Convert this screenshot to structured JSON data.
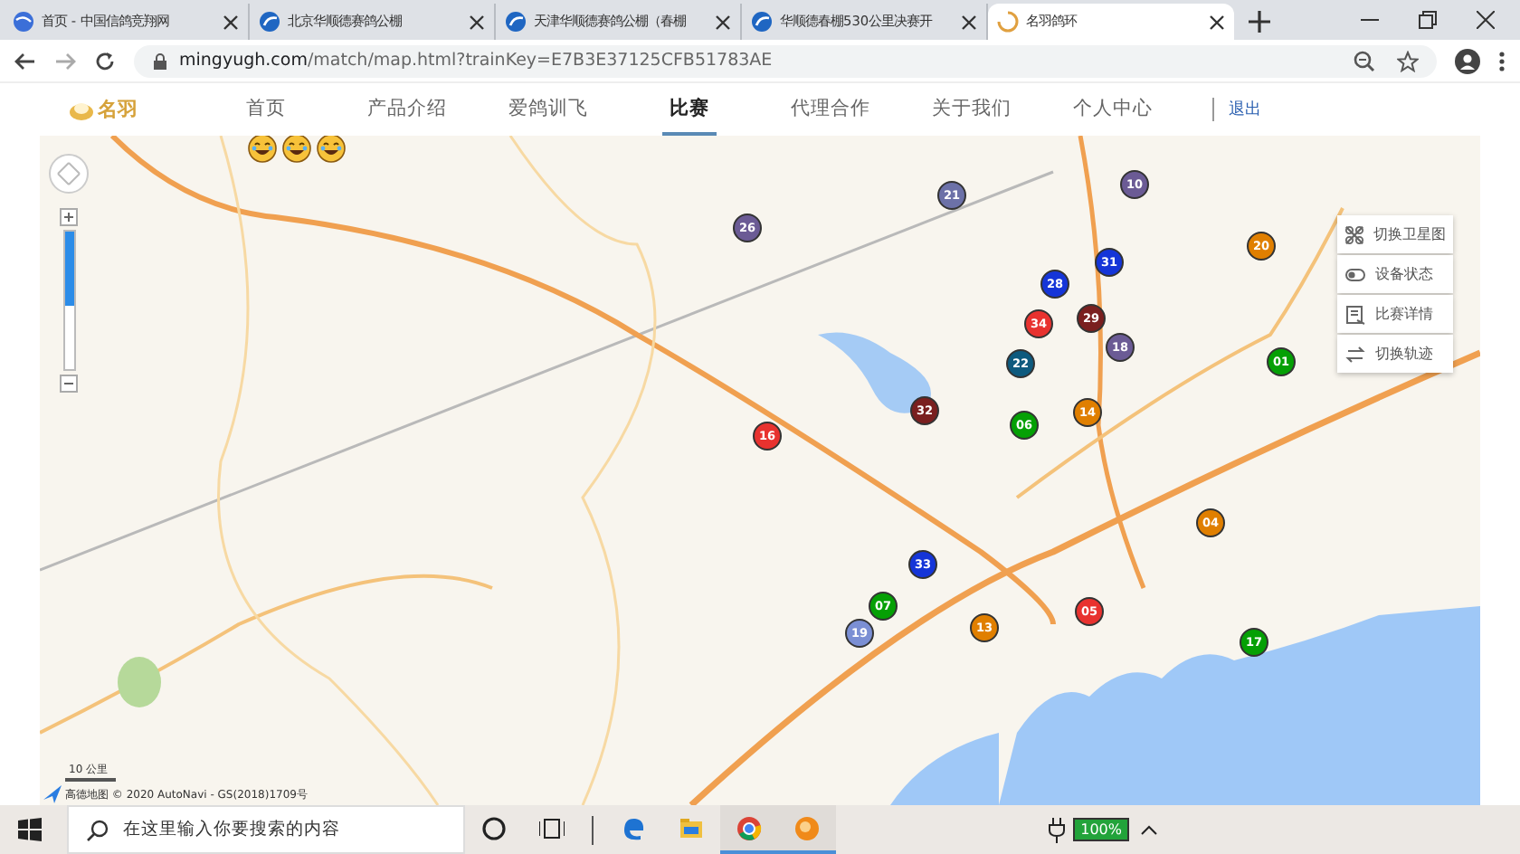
{
  "browser": {
    "tabs": [
      {
        "title": "首页 - 中国信鸽竞翔网",
        "kind": "globe",
        "selected": false
      },
      {
        "title": "北京华顺德赛鸽公棚",
        "kind": "site",
        "selected": false
      },
      {
        "title": "天津华顺德赛鸽公棚（春棚",
        "kind": "site",
        "selected": false
      },
      {
        "title": "华顺德春棚530公里决赛开",
        "kind": "site",
        "selected": false
      },
      {
        "title": "名羽鸽环",
        "kind": "loading",
        "selected": true
      }
    ],
    "url": {
      "host": "mingyugh.com",
      "path": "/match/map.html?trainKey=E7B3E37125CFB51783AE"
    }
  },
  "site": {
    "logo": "名羽",
    "nav": [
      {
        "label": "首页",
        "selected": false
      },
      {
        "label": "产品介绍",
        "selected": false
      },
      {
        "label": "爱鸽训飞",
        "selected": false
      },
      {
        "label": "比赛",
        "selected": true
      },
      {
        "label": "代理合作",
        "selected": false
      },
      {
        "label": "关于我们",
        "selected": false
      },
      {
        "label": "个人中心",
        "selected": false
      }
    ],
    "logout": "退出"
  },
  "map": {
    "zoom": {
      "level": 0.54
    },
    "markers": [
      {
        "number": "21",
        "color": "#6c71a8"
      },
      {
        "number": "10",
        "color": "#6b5b95"
      },
      {
        "number": "26",
        "color": "#6b5b95"
      },
      {
        "number": "20",
        "color": "#e07f00"
      },
      {
        "number": "31",
        "color": "#1535d8"
      },
      {
        "number": "28",
        "color": "#1535d8"
      },
      {
        "number": "34",
        "color": "#e8322f"
      },
      {
        "number": "29",
        "color": "#7a1f1f"
      },
      {
        "number": "18",
        "color": "#6b5b95"
      },
      {
        "number": "22",
        "color": "#0e5a7e"
      },
      {
        "number": "01",
        "color": "#05a005"
      },
      {
        "number": "32",
        "color": "#7a1f1f"
      },
      {
        "number": "16",
        "color": "#e8322f"
      },
      {
        "number": "06",
        "color": "#05a005"
      },
      {
        "number": "14",
        "color": "#e07f00"
      },
      {
        "number": "04",
        "color": "#e07f00"
      },
      {
        "number": "33",
        "color": "#1535d8"
      },
      {
        "number": "07",
        "color": "#05a005"
      },
      {
        "number": "19",
        "color": "#7b8fd4"
      },
      {
        "number": "13",
        "color": "#e07f00"
      },
      {
        "number": "05",
        "color": "#e8322f"
      },
      {
        "number": "17",
        "color": "#05a005"
      }
    ],
    "menu": [
      {
        "label": "切换卫星图",
        "kind": "satellite"
      },
      {
        "label": "设备状态",
        "kind": "status"
      },
      {
        "label": "比赛详情",
        "kind": "details"
      },
      {
        "label": "切换轨迹",
        "kind": "track"
      }
    ],
    "scale": "10 公里",
    "attribution": "高德地图 © 2020 AutoNavi - GS(2018)1709号"
  },
  "taskbar": {
    "search_placeholder": "在这里输入你要搜索的内容",
    "apps": [
      {
        "kind": "cortana",
        "active": false
      },
      {
        "kind": "taskview",
        "active": false
      },
      {
        "kind": "edge",
        "active": false
      },
      {
        "kind": "explorer",
        "active": false
      },
      {
        "kind": "chrome",
        "active": true
      },
      {
        "kind": "orange",
        "active": true
      }
    ],
    "battery": "100%"
  }
}
